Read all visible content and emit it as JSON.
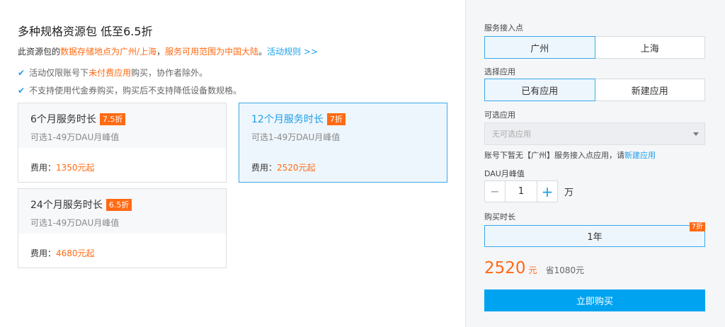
{
  "promo": {
    "title": "多种规格资源包 低至6.5折",
    "desc_pre": "此资源包的",
    "desc_orange1": "数据存储地点为广州/上海",
    "desc_mid": "，",
    "desc_orange2": "服务可用范围为中国大陆",
    "desc_post": "。",
    "rules_link": "活动规则 >>",
    "note1_pre": "活动仅限账号下",
    "note1_orange": "未付费应用",
    "note1_post": "购买，协作者除外。",
    "note2": "不支持使用代金券购买，购买后不支持降低设备数规格。"
  },
  "packages": [
    {
      "name": "6个月服务时长",
      "badge": "7.5折",
      "range": "可选1-49万DAU月峰值",
      "fee_label": "费用：",
      "price": "1350元起"
    },
    {
      "name": "12个月服务时长",
      "badge": "7折",
      "range": "可选1-49万DAU月峰值",
      "fee_label": "费用：",
      "price": "2520元起"
    },
    {
      "name": "24个月服务时长",
      "badge": "6.5折",
      "range": "可选1-49万DAU月峰值",
      "fee_label": "费用：",
      "price": "4680元起"
    }
  ],
  "order": {
    "access_label": "服务接入点",
    "access_options": [
      "广州",
      "上海"
    ],
    "app_label": "选择应用",
    "app_options": [
      "已有应用",
      "新建应用"
    ],
    "optional_app_label": "可选应用",
    "optional_app_placeholder": "无可选应用",
    "hint_pre": "账号下暂无【广州】服务接入点应用，请",
    "hint_link": "新建应用",
    "dau_label": "DAU月峰值",
    "dau_value": "1",
    "dau_unit": "万",
    "duration_label": "购买时长",
    "duration_value": "1年",
    "duration_badge": "7折",
    "total_amount": "2520",
    "total_unit": "元",
    "savings": "省1080元",
    "buy_label": "立即购买"
  },
  "colors": {
    "accent": "#1e9fe8",
    "highlight": "#ff6a13",
    "buy_button": "#00a3f0"
  }
}
